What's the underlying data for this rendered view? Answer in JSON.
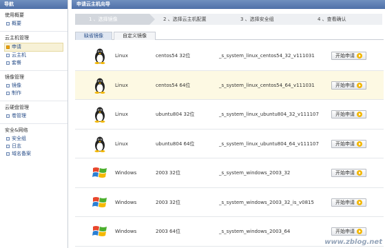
{
  "sidebar": {
    "title": "导航",
    "groups": [
      {
        "title": "使用概要",
        "items": [
          {
            "label": "概要"
          }
        ]
      },
      {
        "title": "云主机管理",
        "items": [
          {
            "label": "申请"
          },
          {
            "label": "云主机"
          },
          {
            "label": "套餐"
          }
        ]
      },
      {
        "title": "镜像管理",
        "items": [
          {
            "label": "镜像"
          },
          {
            "label": "制作"
          }
        ]
      },
      {
        "title": "云硬盘管理",
        "items": [
          {
            "label": "卷管理"
          }
        ]
      },
      {
        "title": "安全&网络",
        "items": [
          {
            "label": "安全组"
          },
          {
            "label": "日志"
          },
          {
            "label": "域名备案"
          }
        ]
      }
    ]
  },
  "main": {
    "title": "申请云主机向导",
    "steps": [
      "1 、选择镜像",
      "2 、选择云主机配置",
      "3 、选择安全组",
      "4 、查看确认"
    ],
    "tabs": [
      "缺省镜像",
      "自定义镜像"
    ],
    "start_label": "开始申请",
    "rows": [
      {
        "os": "Linux",
        "version": "centos54 32位",
        "template": "_s_system_linux_centos54_32_v111031",
        "icon": "linux-tux-icon"
      },
      {
        "os": "Linux",
        "version": "centos54 64位",
        "template": "_s_system_linux_centos54_64_v111031",
        "icon": "linux-tux-icon"
      },
      {
        "os": "Linux",
        "version": "ubuntu804 32位",
        "template": "_s_system_linux_ubuntu804_32_v111107",
        "icon": "linux-tux-icon"
      },
      {
        "os": "Linux",
        "version": "ubuntu804 64位",
        "template": "_s_system_linux_ubuntu804_64_v111107",
        "icon": "linux-tux-icon"
      },
      {
        "os": "Windows",
        "version": "2003 32位",
        "template": "_s_system_windows_2003_32",
        "icon": "windows-logo-icon"
      },
      {
        "os": "Windows",
        "version": "2003 32位",
        "template": "_s_system_windows_2003_32_is_v0815",
        "icon": "windows-logo-icon"
      },
      {
        "os": "Windows",
        "version": "2003 64位",
        "template": "_s_system_windows_2003_64",
        "icon": "windows-logo-icon"
      }
    ]
  },
  "watermark": "www.zblog.net"
}
